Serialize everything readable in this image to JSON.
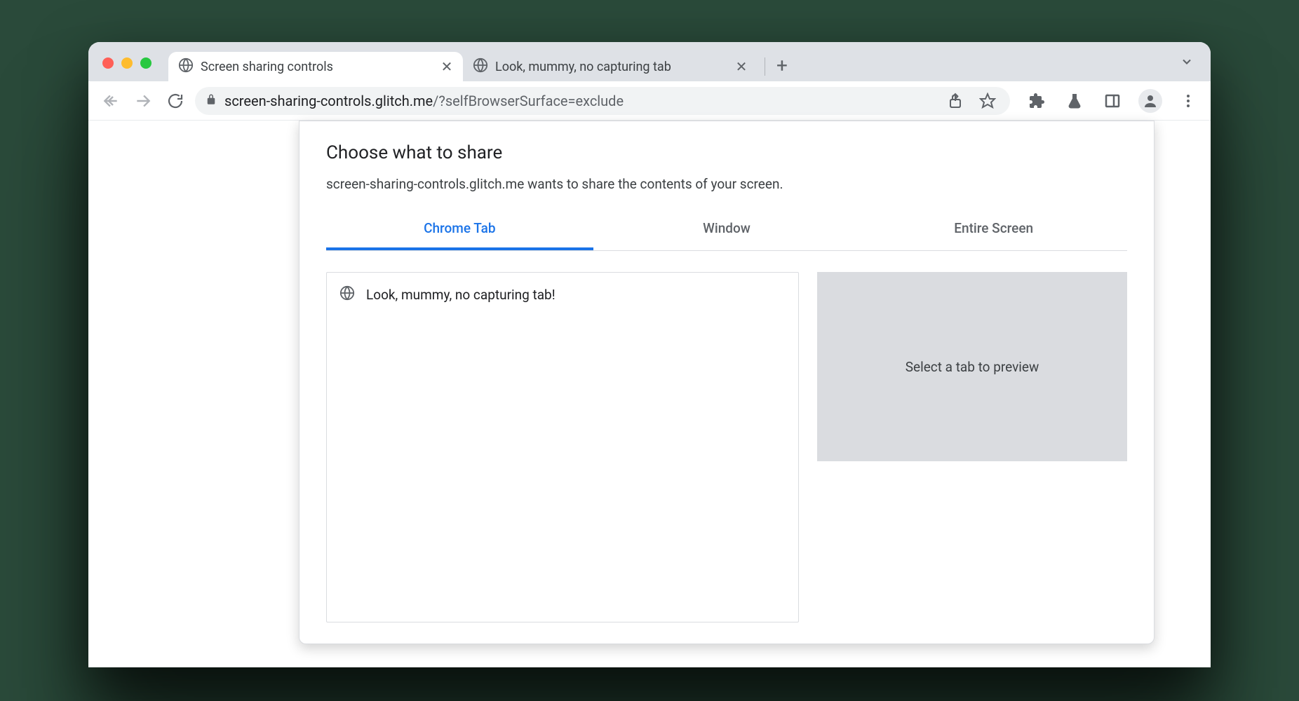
{
  "browser": {
    "tabs": [
      {
        "title": "Screen sharing controls",
        "active": true
      },
      {
        "title": "Look, mummy, no capturing tab",
        "active": false
      }
    ],
    "url_host": "screen-sharing-controls.glitch.me",
    "url_path": "/",
    "url_query": "?selfBrowserSurface=exclude"
  },
  "dialog": {
    "title": "Choose what to share",
    "subtitle": "screen-sharing-controls.glitch.me wants to share the contents of your screen.",
    "tabs": [
      {
        "label": "Chrome Tab",
        "active": true
      },
      {
        "label": "Window",
        "active": false
      },
      {
        "label": "Entire Screen",
        "active": false
      }
    ],
    "list_items": [
      {
        "label": "Look, mummy, no capturing tab!"
      }
    ],
    "preview_placeholder": "Select a tab to preview"
  }
}
